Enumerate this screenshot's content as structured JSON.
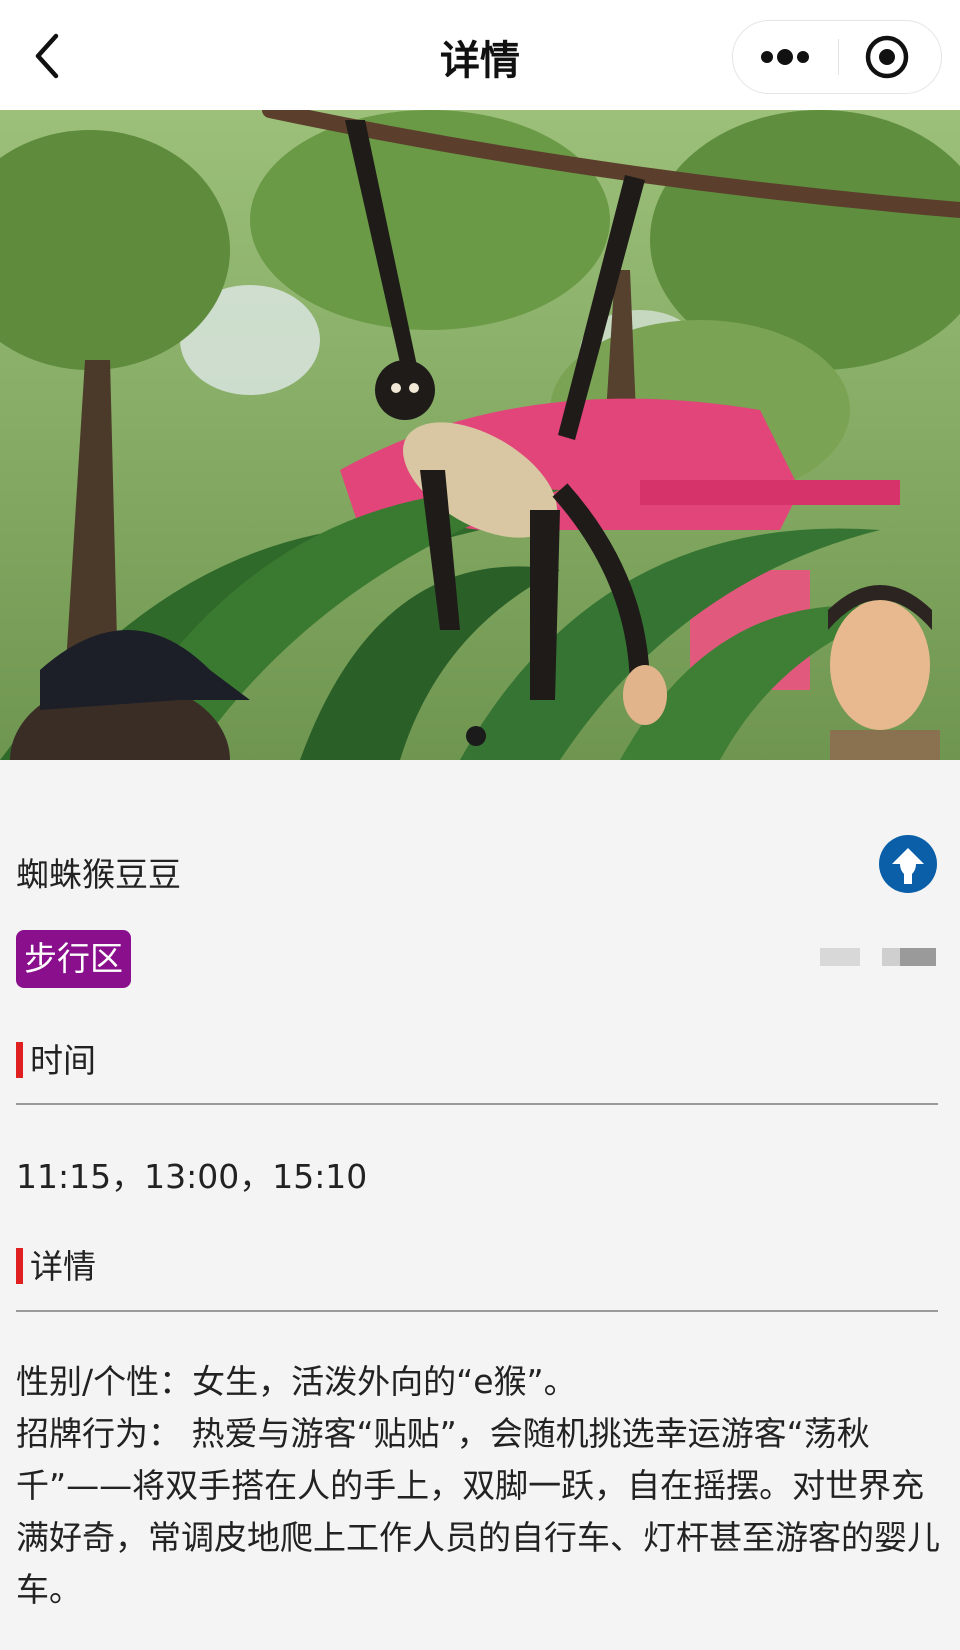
{
  "header": {
    "title": "详情"
  },
  "icons": {
    "back": "chevron-left-icon",
    "more": "more-dots-icon",
    "target": "target-icon",
    "up": "arrow-up-circle-icon"
  },
  "hero": {
    "image_alt": "spider monkey hanging from a branch",
    "page_indicator_count": 1,
    "active_index": 0
  },
  "animal": {
    "name": "蜘蛛猴豆豆",
    "area_tag": "步行区",
    "tag_color": "#8a0f8c"
  },
  "sections": {
    "time_heading": "时间",
    "times": "11:15，13:00，15:10",
    "detail_heading": "详情",
    "detail_lines": [
      "性别/个性：女生，活泼外向的“e猴”。",
      "招牌行为：  热爱与游客“贴贴”，会随机挑选幸运游客“荡秋千”——将双手搭在人的手上，双脚一跃，自在摇摆。对世界充满好奇，常调皮地爬上工作人员的自行车、灯杆甚至游客的婴儿车。"
    ]
  },
  "colors": {
    "accent_blue": "#0a5fa8",
    "section_bar": "#e02020"
  }
}
